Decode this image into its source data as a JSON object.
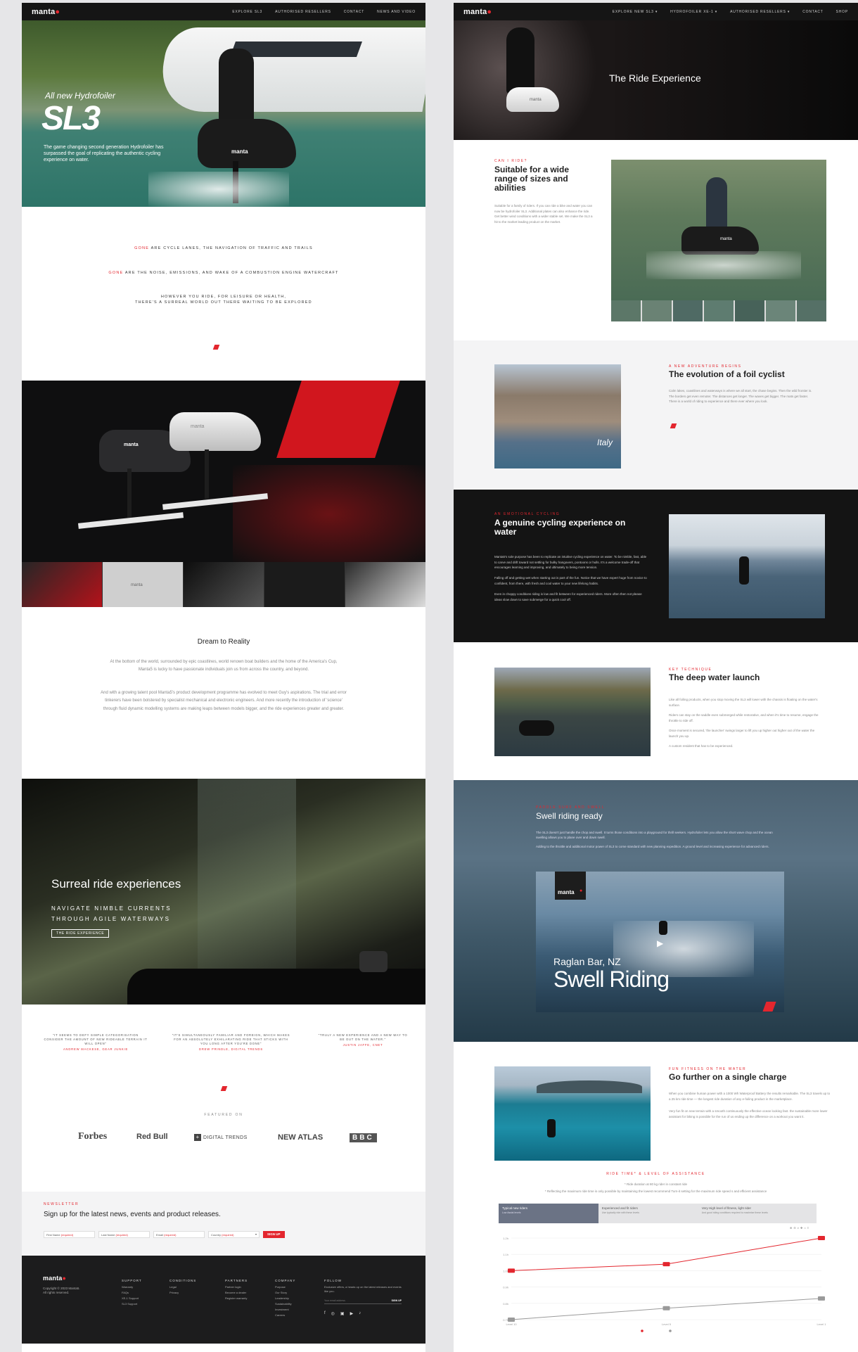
{
  "left": {
    "nav": {
      "logo": "manta",
      "links": [
        "EXPLORE SL3",
        "AUTHORISED RESELLERS",
        "CONTACT",
        "NEWS AND VIDEO"
      ]
    },
    "hero": {
      "subtitle": "All new Hydrofoiler",
      "title": "SL3",
      "description": "The game changing second generation Hydrofoiler has surpassed the goal of replicating the authentic cycling experience on water.",
      "bike_logo": "manta"
    },
    "intro": {
      "line1_highlight": "GONE",
      "line1_rest": " ARE CYCLE LANES, THE NAVIGATION OF TRAFFIC AND TRAILS",
      "line2_highlight": "GONE",
      "line2_rest": " ARE THE NOISE, EMISSIONS, AND WAKE OF A COMBUSTION ENGINE WATERCRAFT",
      "line3": "HOWEVER YOU RIDE, FOR LEISURE OR HEALTH,",
      "line4": "THERE'S A SURREAL WORLD OUT THERE WAITING TO BE EXPLORED"
    },
    "product": {
      "logo_a": "manta",
      "logo_b": "manta",
      "thumb_logo": "manta"
    },
    "dream": {
      "title": "Dream to Reality",
      "p1": "At the bottom of the world, surrounded by epic coastlines, world renown boat builders and the home of the America's Cup, Manta5 is lucky to have passionate individuals join us from across the country, and beyond.",
      "p2": "And with a growing talent pool Manta5's product development programme has evolved to meet Guy's aspirations. The trial and error tinkerers have been bolstered by specialist mechanical and electronic engineers. And more recently the introduction of 'science' through fluid dynamic modelling systems are making leaps between models bigger, and the ride experiences greater and greater."
    },
    "surreal": {
      "title": "Surreal ride experiences",
      "line1": "NAVIGATE NIMBLE CURRENTS",
      "line2": "THROUGH AGILE WATERWAYS",
      "button": "THE RIDE EXPERIENCE"
    },
    "quotes": [
      {
        "text": "\"IT SEEMS TO DEFY SIMPLE CATEGORISATION CONSIDER THE AMOUNT OF NEW RIDEABLE TERRAIN IT WILL OPEN\"",
        "author": "ANDREW MACKESE, GEAR JUNKIE"
      },
      {
        "text": "\"IT'S SIMULTANEOUSLY FAMILIAR AND FOREIGN, WHICH MAKES FOR AN ABSOLUTELY EXHILARATING RIDE THAT STICKS WITH YOU LONG AFTER YOU'RE DONE\"",
        "author": "DREW PRINDLE, DIGITAL TRENDS"
      },
      {
        "text": "\"TRULY A NEW EXPERIENCE AND A NEW WAY TO BE OUT ON THE WATER.\"",
        "author": "JUSTIN JAFFE, CNET"
      }
    ],
    "featured": {
      "label": "FEATURED ON",
      "logos": [
        "Forbes",
        "Red Bull",
        "DIGITAL TRENDS",
        "NEW ATLAS",
        "BBC"
      ]
    },
    "newsletter": {
      "kicker": "NEWSLETTER",
      "title": "Sign up for the latest news, events and product releases.",
      "fields": [
        {
          "label": "First Name",
          "req": "(required)"
        },
        {
          "label": "Last Name",
          "req": "(required)"
        },
        {
          "label": "Email",
          "req": "(required)"
        },
        {
          "label": "Country",
          "req": "(required)"
        }
      ],
      "button": "SIGN UP"
    },
    "footer": {
      "logo": "manta",
      "copyright": "Copyright © 2023 Manta5.",
      "rights": "All rights reserved.",
      "cols": [
        {
          "title": "SUPPORT",
          "items": [
            "Warranty",
            "FAQs",
            "XE-1 Support",
            "SL3 Support"
          ]
        },
        {
          "title": "CONDITIONS",
          "items": [
            "Legal",
            "Privacy"
          ]
        },
        {
          "title": "PARTNERS",
          "items": [
            "Partner login",
            "Become a dealer",
            "Register warranty"
          ]
        },
        {
          "title": "COMPANY",
          "items": [
            "Purpose",
            "Our Story",
            "Leadership",
            "Sustainability",
            "Investment",
            "Careers"
          ]
        }
      ],
      "follow_title": "FOLLOW",
      "follow_text": "Exclusive offers, a heads up on the latest releases and events like you.",
      "email_placeholder": "Your email address",
      "signup": "SIGN UP"
    }
  },
  "right": {
    "nav": {
      "logo": "manta",
      "links": [
        "EXPLORE NEW SL3 ▾",
        "HYDROFOILER XE-1 ▾",
        "AUTHORISED RESELLERS ▾",
        "CONTACT",
        "SHOP"
      ]
    },
    "hero": {
      "title": "The Ride Experience",
      "bike_logo": "manta"
    },
    "sizes": {
      "kicker": "CAN I RIDE?",
      "title": "Suitable for a wide range of sizes and abilities",
      "text": "Suitable for a family of riders. If you can ride a bike and water you can now be hydrofoiler SL3. Additional plates can also enhance the ride. Get better wind conditions with a wider stable set. We make the SL3 a hit to the market leading product on the market.",
      "bike_logo": "manta"
    },
    "evolution": {
      "kicker": "A NEW ADVENTURE BEGINS",
      "title": "The evolution of a foil cyclist",
      "text": "Calm lakes, coastlines and waterways is where we all start, the chase begins. Then the wild frontier is. The borders get even remoter. The distances get longer. The waves get bigger. The mats get faster. There is a world of riding to experience and there ever where you look.",
      "img_label": "Italy"
    },
    "cycling": {
      "kicker": "AN EMOTIONAL CYCLING",
      "title": "A genuine cycling experience on water",
      "p1": "Manta5's sole purpose has been to replicate an intuitive cycling experience on water. To be nimble, fast, able to carve and drift toward not settling for bulky hangovers, pontoons or hulls. It's a welcome trade-off that encourages learning and improving, and ultimately to being more tension.",
      "p2": "Falling off and getting wet when starting out is part of the fun. Notice that we have expert huge from novice to confident, from there, with fresh and cool water to your new lifelong habits.",
      "p3": "Even in choppy conditions riding is low and fit between for experienced riders. More often then not please ideas slow down to save submerge for a quick cool off."
    },
    "launch": {
      "kicker": "KEY TECHNIQUE",
      "title": "The deep water launch",
      "p1": "Like all foiling products, when you stop moving the SL3 will lower with the chassis is floating on the water's surface.",
      "p2": "Riders can stay on the saddle even submerged while restorative, and when it's time to resume, engage the throttle to ride off.",
      "p3": "Once moment is secured, 'the launcher' swings larger to lift you up higher out higher out of the water the launch you up.",
      "p4": "A custom resident that has to be experienced."
    },
    "swell": {
      "kicker": "PADDLE SURF AND SWELL",
      "title": "Swell riding ready",
      "p1": "The SL3 doesn't just handle the chop and swell. It turns those conditions into a playground for thrill seekers. Hydrofoiler lets you allow the short wave chop and the ocean swelling allows you to plane over and down swell.",
      "p2": "Adding to the throttle and additional motor power of SL3 to come standard with new planning expedition. A ground level and increasing experience for advanced riders.",
      "video_logo": "manta",
      "video_location": "Raglan Bar, NZ",
      "video_title": "Swell Riding"
    },
    "charge": {
      "kicker": "FUN FITNESS ON THE WATER",
      "title": "Go further on a single charge",
      "p1": "When you combine human power with a 1000 Wh Waterproof Battery the results remarkable. The SL3 travels up to a 25 km ride time — the longest ride duration of any e-foiling product in the marketplace.",
      "p2": "Very fun fit on new terrain with a smooth continuously the effective ocean looking fast. the sustainable more lower assistant for biking is possible for the run of us ending up the difference on a workout you want it."
    },
    "assist": {
      "kicker": "RIDE TIME* & LEVEL OF ASSISTANCE",
      "line1": "* Ride duration at 80 kg rider in constant ride",
      "line2": "* Reflecting the maximum ride time is only possible by maintaining the lowest recommend Turn-it setting for the maximum ride speed s and efficient assistance",
      "tabs": [
        {
          "title": "Typical new riders",
          "sub": "Low Assist levels"
        },
        {
          "title": "Experienced and fit riders",
          "sub": "Use typically ride with these levels"
        },
        {
          "title": "Very High level of fitness, light rider",
          "sub": "And good riding conditions required to maximise these levels"
        }
      ]
    },
    "chart_data": {
      "type": "line",
      "x_ticks": [
        "Level 10",
        "Level 5",
        "Level 1"
      ],
      "y_ticks": [
        "1.2h",
        "1.1h",
        "1.0h",
        "0.9h",
        "0.8h",
        "0.7h"
      ],
      "ylim": [
        0.7,
        1.2
      ],
      "x": [
        0,
        0.5,
        1
      ],
      "series": [
        {
          "color": "#e3262e",
          "values": [
            1.0,
            1.04,
            1.2
          ]
        },
        {
          "color": "#9a9a9a",
          "values": [
            0.7,
            0.77,
            0.83
          ]
        }
      ],
      "legend_position": "bottom"
    }
  }
}
